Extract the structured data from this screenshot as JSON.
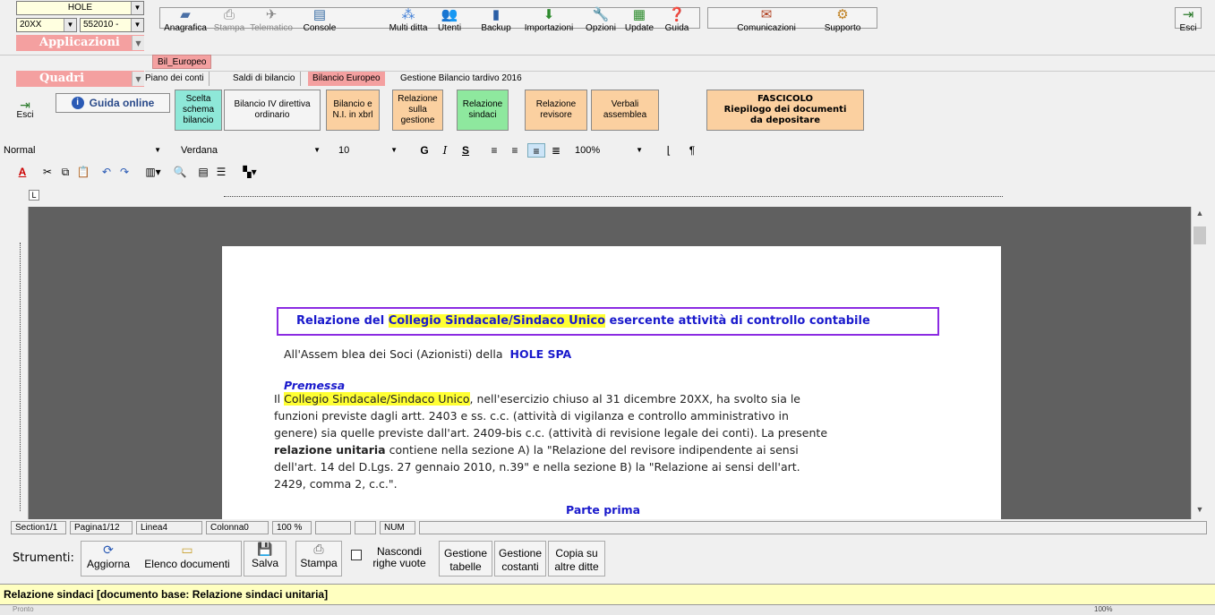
{
  "toolbar": {
    "company": "HOLE",
    "year": "20XX",
    "code": "552010 -",
    "applicazioni": "Applicazioni",
    "quadri": "Quadri",
    "buttons": {
      "anagrafica": "Anagrafica",
      "stampa": "Stampa",
      "telematico": "Telematico",
      "console": "Console",
      "multi_ditta": "Multi ditta",
      "utenti": "Utenti",
      "backup": "Backup",
      "importazioni": "Importazioni",
      "opzioni": "Opzioni",
      "update": "Update",
      "guida": "Guida",
      "comunicazioni": "Comunicazioni",
      "supporto": "Supporto",
      "esci": "Esci"
    }
  },
  "tabs": {
    "app_tab": "Bil_Europeo",
    "items": [
      "Piano dei conti",
      "Saldi di bilancio",
      "Bilancio Europeo",
      "Gestione Bilancio tardivo 2016"
    ]
  },
  "ribbon": {
    "esci": "Esci",
    "guida_online": "Guida online",
    "scelta": "Scelta schema bilancio",
    "bilancio_iv": "Bilancio IV direttiva ordinario",
    "bilancio_xbrl": "Bilancio e N.I. in xbrl",
    "relazione_gestione": "Relazione sulla gestione",
    "relazione_sindaci": "Relazione sindaci",
    "relazione_revisore": "Relazione revisore",
    "verbali": "Verbali assemblea",
    "fascicolo_title": "FASCICOLO",
    "fascicolo_sub1": "Riepilogo dei documenti",
    "fascicolo_sub2": "da depositare"
  },
  "format": {
    "style": "Normal",
    "font": "Verdana",
    "size": "10",
    "zoom": "100%"
  },
  "document": {
    "title_prefix": "Relazione del ",
    "title_highlight": "Collegio Sindacale/Sindaco Unico",
    "title_suffix": " esercente attività di controllo contabile",
    "assemblea": "All'Assem blea dei Soci (Azionisti) della",
    "company": "HOLE SPA",
    "premessa": "Premessa",
    "p_line1_pre": "Il ",
    "p_line1_hl": "Collegio Sindacale/Sindaco Unico",
    "p_line1_post": ", nell'esercizio chiuso al 31 dicembre 20XX, ha svolto sia le",
    "p_line2": "funzioni previste dagli artt. 2403 e ss. c.c. (attività di vigilanza e controllo amministrativo in",
    "p_line3": "genere) sia quelle previste dall'art. 2409-bis c.c. (attività di revisione legale dei conti). La presente",
    "p_line4_bold": "relazione unitaria",
    "p_line4_rest": " contiene nella sezione A) la \"Relazione del revisore indipendente ai sensi",
    "p_line5": "dell'art. 14 del D.Lgs. 27 gennaio 2010, n.39\" e nella sezione B) la \"Relazione ai sensi dell'art.",
    "p_line6": "2429, comma 2, c.c.\".",
    "parte_prima": "Parte prima"
  },
  "status": {
    "section": "Section1/1",
    "pagina": "Pagina1/12",
    "linea": "Linea4",
    "colonna": "Colonna0",
    "zoom": "100 %",
    "num": "NUM"
  },
  "tools": {
    "label": "Strumenti:",
    "aggiorna": "Aggiorna",
    "elenco": "Elenco documenti",
    "salva": "Salva",
    "stampa": "Stampa",
    "nascondi": "Nascondi righe vuote",
    "gestione_tabelle": "Gestione tabelle",
    "gestione_costanti": "Gestione costanti",
    "copia": "Copia su altre ditte"
  },
  "message": "Relazione sindaci [documento base: Relazione sindaci unitaria]",
  "bottom": {
    "status": "Pronto",
    "zoom": "100%"
  }
}
